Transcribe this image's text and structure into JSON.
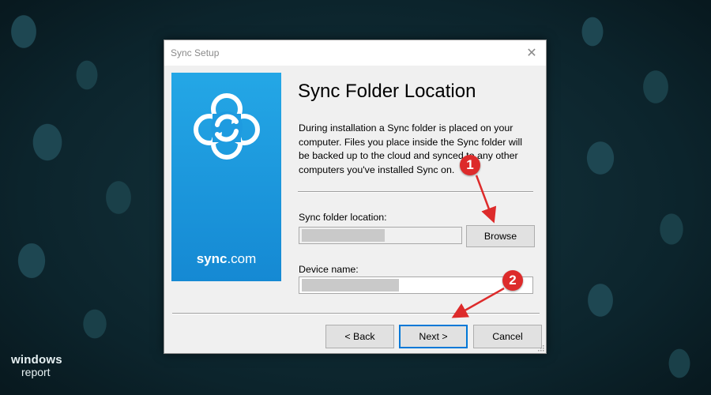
{
  "window": {
    "title": "Sync Setup",
    "close_glyph": "✕"
  },
  "banner": {
    "brand_bold": "sync",
    "brand_light": ".com",
    "icon": "sync-cloud-logo-icon",
    "color": "#1e9be0"
  },
  "page": {
    "heading": "Sync Folder Location",
    "description": "During installation a Sync folder is placed on your computer. Files you place inside the Sync folder will be backed up to the cloud and synced to any other computers you've installed Sync on."
  },
  "form": {
    "folder_label": "Sync folder location:",
    "folder_value": "",
    "browse_label": "Browse",
    "device_label": "Device name:",
    "device_value": ""
  },
  "footer": {
    "back_label": "< Back",
    "next_label": "Next >",
    "cancel_label": "Cancel"
  },
  "annotations": {
    "step1": "1",
    "step2": "2",
    "color": "#dd2b2b"
  },
  "watermark": {
    "line1": "windows",
    "line2": "report"
  }
}
